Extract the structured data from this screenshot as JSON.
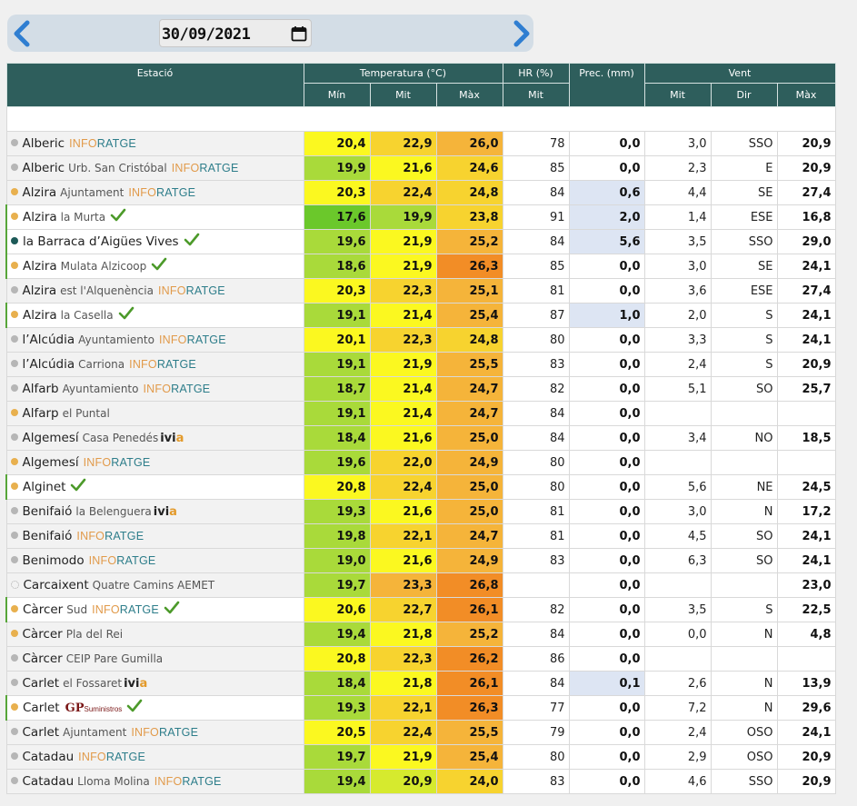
{
  "date_value": "30/09/2021",
  "headers": {
    "station": "Estació",
    "temperature": "Temperatura (°C)",
    "humidity": "HR (%)",
    "precipitation": "Prec. (mm)",
    "wind": "Vent",
    "t_min": "Mín",
    "t_mit": "Mit",
    "t_max": "Màx",
    "hr_mit": "Mit",
    "w_mit": "Mit",
    "w_dir": "Dir",
    "w_max": "Màx"
  },
  "provider_labels": {
    "inforatge_a": "INFO",
    "inforatge_b": "RATGE",
    "ivia_a": "ivi",
    "ivia_b": "a",
    "gp_a": "GP",
    "gp_b": "Suministros"
  },
  "colors": {
    "header_bg": "#2e5e5c",
    "t_dark_green": "#6bc82b",
    "t_green": "#a9da3a",
    "t_yellow_green": "#d6ea2e",
    "t_yellow": "#fbf820",
    "t_gold": "#f7d32f",
    "t_orange_light": "#f5b43a",
    "t_orange": "#f28d26",
    "precip_highlight": "#dde5f3"
  },
  "rows": [
    {
      "name": "Alberic",
      "sub": "",
      "dot": "gray",
      "logo": "inforatge",
      "check": false,
      "tmin": "20,4",
      "tmin_c": "t_yellow",
      "tmit": "22,9",
      "tmit_c": "t_gold",
      "tmax": "26,0",
      "tmax_c": "t_orange_light",
      "hr": "78",
      "prec": "0,0",
      "prec_hl": false,
      "vmit": "3,0",
      "dir": "SSO",
      "vmax": "20,9"
    },
    {
      "name": "Alberic",
      "sub": "Urb. San Cristóbal",
      "dot": "gray",
      "logo": "inforatge",
      "check": false,
      "tmin": "19,9",
      "tmin_c": "t_green",
      "tmit": "21,6",
      "tmit_c": "t_yellow",
      "tmax": "24,6",
      "tmax_c": "t_gold",
      "hr": "85",
      "prec": "0,0",
      "prec_hl": false,
      "vmit": "2,3",
      "dir": "E",
      "vmax": "20,9"
    },
    {
      "name": "Alzira",
      "sub": "Ajuntament",
      "dot": "orange",
      "logo": "inforatge",
      "check": false,
      "tmin": "20,3",
      "tmin_c": "t_yellow",
      "tmit": "22,4",
      "tmit_c": "t_gold",
      "tmax": "24,8",
      "tmax_c": "t_gold",
      "hr": "84",
      "prec": "0,6",
      "prec_hl": true,
      "vmit": "4,4",
      "dir": "SE",
      "vmax": "27,4"
    },
    {
      "name": "Alzira",
      "sub": "la Murta",
      "dot": "orange",
      "logo": "",
      "check": true,
      "tmin": "17,6",
      "tmin_c": "t_dark_green",
      "tmit": "19,9",
      "tmit_c": "t_green",
      "tmax": "23,8",
      "tmax_c": "t_gold",
      "hr": "91",
      "prec": "2,0",
      "prec_hl": true,
      "vmit": "1,4",
      "dir": "ESE",
      "vmax": "16,8"
    },
    {
      "name": "la Barraca d’Aigües Vives",
      "sub": "",
      "dot": "teal",
      "logo": "",
      "check": true,
      "tmin": "19,6",
      "tmin_c": "t_green",
      "tmit": "21,9",
      "tmit_c": "t_yellow",
      "tmax": "25,2",
      "tmax_c": "t_orange_light",
      "hr": "84",
      "prec": "5,6",
      "prec_hl": true,
      "vmit": "3,5",
      "dir": "SSO",
      "vmax": "29,0"
    },
    {
      "name": "Alzira",
      "sub": "Mulata Alzicoop",
      "dot": "orange",
      "logo": "",
      "check": true,
      "tmin": "18,6",
      "tmin_c": "t_green",
      "tmit": "21,9",
      "tmit_c": "t_yellow",
      "tmax": "26,3",
      "tmax_c": "t_orange",
      "hr": "85",
      "prec": "0,0",
      "prec_hl": false,
      "vmit": "3,0",
      "dir": "SE",
      "vmax": "24,1"
    },
    {
      "name": "Alzira",
      "sub": "est l'Alquenència",
      "dot": "gray",
      "logo": "inforatge",
      "check": false,
      "tmin": "20,3",
      "tmin_c": "t_yellow",
      "tmit": "22,3",
      "tmit_c": "t_gold",
      "tmax": "25,1",
      "tmax_c": "t_orange_light",
      "hr": "81",
      "prec": "0,0",
      "prec_hl": false,
      "vmit": "3,6",
      "dir": "ESE",
      "vmax": "27,4"
    },
    {
      "name": "Alzira",
      "sub": "la Casella",
      "dot": "orange",
      "logo": "",
      "check": true,
      "tmin": "19,1",
      "tmin_c": "t_green",
      "tmit": "21,4",
      "tmit_c": "t_yellow",
      "tmax": "25,4",
      "tmax_c": "t_orange_light",
      "hr": "87",
      "prec": "1,0",
      "prec_hl": true,
      "vmit": "2,0",
      "dir": "S",
      "vmax": "24,1"
    },
    {
      "name": "l’Alcúdia",
      "sub": "Ayuntamiento",
      "dot": "gray",
      "logo": "inforatge",
      "check": false,
      "tmin": "20,1",
      "tmin_c": "t_yellow",
      "tmit": "22,3",
      "tmit_c": "t_gold",
      "tmax": "24,8",
      "tmax_c": "t_gold",
      "hr": "80",
      "prec": "0,0",
      "prec_hl": false,
      "vmit": "3,3",
      "dir": "S",
      "vmax": "24,1"
    },
    {
      "name": "l’Alcúdia",
      "sub": "Carriona",
      "dot": "gray",
      "logo": "inforatge",
      "check": false,
      "tmin": "19,1",
      "tmin_c": "t_green",
      "tmit": "21,9",
      "tmit_c": "t_yellow",
      "tmax": "25,5",
      "tmax_c": "t_orange_light",
      "hr": "83",
      "prec": "0,0",
      "prec_hl": false,
      "vmit": "2,4",
      "dir": "S",
      "vmax": "20,9"
    },
    {
      "name": "Alfarb",
      "sub": "Ayuntamiento",
      "dot": "gray",
      "logo": "inforatge",
      "check": false,
      "tmin": "18,7",
      "tmin_c": "t_green",
      "tmit": "21,4",
      "tmit_c": "t_yellow",
      "tmax": "24,7",
      "tmax_c": "t_orange_light",
      "hr": "82",
      "prec": "0,0",
      "prec_hl": false,
      "vmit": "5,1",
      "dir": "SO",
      "vmax": "25,7"
    },
    {
      "name": "Alfarp",
      "sub": "el Puntal",
      "dot": "orange",
      "logo": "",
      "check": false,
      "tmin": "19,1",
      "tmin_c": "t_green",
      "tmit": "21,4",
      "tmit_c": "t_yellow",
      "tmax": "24,7",
      "tmax_c": "t_orange_light",
      "hr": "84",
      "prec": "0,0",
      "prec_hl": false,
      "vmit": "",
      "dir": "",
      "vmax": ""
    },
    {
      "name": "Algemesí",
      "sub": "Casa Penedés",
      "dot": "gray",
      "logo": "ivia",
      "check": false,
      "tmin": "18,4",
      "tmin_c": "t_green",
      "tmit": "21,6",
      "tmit_c": "t_yellow",
      "tmax": "25,0",
      "tmax_c": "t_orange_light",
      "hr": "84",
      "prec": "0,0",
      "prec_hl": false,
      "vmit": "3,4",
      "dir": "NO",
      "vmax": "18,5"
    },
    {
      "name": "Algemesí",
      "sub": "",
      "dot": "orange",
      "logo": "inforatge",
      "check": false,
      "tmin": "19,6",
      "tmin_c": "t_green",
      "tmit": "22,0",
      "tmit_c": "t_gold",
      "tmax": "24,9",
      "tmax_c": "t_orange_light",
      "hr": "80",
      "prec": "0,0",
      "prec_hl": false,
      "vmit": "",
      "dir": "",
      "vmax": ""
    },
    {
      "name": "Alginet",
      "sub": "",
      "dot": "orange",
      "logo": "",
      "check": true,
      "tmin": "20,8",
      "tmin_c": "t_yellow",
      "tmit": "22,4",
      "tmit_c": "t_gold",
      "tmax": "25,0",
      "tmax_c": "t_orange_light",
      "hr": "80",
      "prec": "0,0",
      "prec_hl": false,
      "vmit": "5,6",
      "dir": "NE",
      "vmax": "24,5"
    },
    {
      "name": "Benifaió",
      "sub": "la Belenguera",
      "dot": "gray",
      "logo": "ivia",
      "check": false,
      "tmin": "19,3",
      "tmin_c": "t_green",
      "tmit": "21,6",
      "tmit_c": "t_yellow",
      "tmax": "25,0",
      "tmax_c": "t_orange_light",
      "hr": "81",
      "prec": "0,0",
      "prec_hl": false,
      "vmit": "3,0",
      "dir": "N",
      "vmax": "17,2"
    },
    {
      "name": "Benifaió",
      "sub": "",
      "dot": "gray",
      "logo": "inforatge",
      "check": false,
      "tmin": "19,8",
      "tmin_c": "t_green",
      "tmit": "22,1",
      "tmit_c": "t_gold",
      "tmax": "24,7",
      "tmax_c": "t_orange_light",
      "hr": "81",
      "prec": "0,0",
      "prec_hl": false,
      "vmit": "4,5",
      "dir": "SO",
      "vmax": "24,1"
    },
    {
      "name": "Benimodo",
      "sub": "",
      "dot": "gray",
      "logo": "inforatge",
      "check": false,
      "tmin": "19,0",
      "tmin_c": "t_green",
      "tmit": "21,6",
      "tmit_c": "t_yellow",
      "tmax": "24,9",
      "tmax_c": "t_orange_light",
      "hr": "83",
      "prec": "0,0",
      "prec_hl": false,
      "vmit": "6,3",
      "dir": "SO",
      "vmax": "24,1"
    },
    {
      "name": "Carcaixent",
      "sub": "Quatre Camins AEMET",
      "dot": "empty",
      "logo": "",
      "check": false,
      "tmin": "19,7",
      "tmin_c": "t_green",
      "tmit": "23,3",
      "tmit_c": "t_orange_light",
      "tmax": "26,8",
      "tmax_c": "t_orange",
      "hr": "",
      "prec": "0,0",
      "prec_hl": false,
      "vmit": "",
      "dir": "",
      "vmax": "23,0"
    },
    {
      "name": "Càrcer",
      "sub": "Sud",
      "dot": "orange",
      "logo": "inforatge",
      "check": true,
      "tmin": "20,6",
      "tmin_c": "t_yellow",
      "tmit": "22,7",
      "tmit_c": "t_gold",
      "tmax": "26,1",
      "tmax_c": "t_orange",
      "hr": "82",
      "prec": "0,0",
      "prec_hl": false,
      "vmit": "3,5",
      "dir": "S",
      "vmax": "22,5"
    },
    {
      "name": "Càrcer",
      "sub": "Pla del Rei",
      "dot": "orange",
      "logo": "",
      "check": false,
      "tmin": "19,4",
      "tmin_c": "t_green",
      "tmit": "21,8",
      "tmit_c": "t_yellow",
      "tmax": "25,2",
      "tmax_c": "t_orange_light",
      "hr": "84",
      "prec": "0,0",
      "prec_hl": false,
      "vmit": "0,0",
      "dir": "N",
      "vmax": "4,8"
    },
    {
      "name": "Càrcer",
      "sub": "CEIP Pare Gumilla",
      "dot": "gray",
      "logo": "",
      "check": false,
      "tmin": "20,8",
      "tmin_c": "t_yellow",
      "tmit": "22,3",
      "tmit_c": "t_gold",
      "tmax": "26,2",
      "tmax_c": "t_orange",
      "hr": "86",
      "prec": "0,0",
      "prec_hl": false,
      "vmit": "",
      "dir": "",
      "vmax": ""
    },
    {
      "name": "Carlet",
      "sub": "el Fossaret",
      "dot": "gray",
      "logo": "ivia",
      "check": false,
      "tmin": "18,4",
      "tmin_c": "t_green",
      "tmit": "21,8",
      "tmit_c": "t_yellow",
      "tmax": "26,1",
      "tmax_c": "t_orange",
      "hr": "84",
      "prec": "0,1",
      "prec_hl": true,
      "vmit": "2,6",
      "dir": "N",
      "vmax": "13,9"
    },
    {
      "name": "Carlet",
      "sub": "",
      "dot": "orange",
      "logo": "gp",
      "check": true,
      "tmin": "19,3",
      "tmin_c": "t_green",
      "tmit": "22,1",
      "tmit_c": "t_gold",
      "tmax": "26,3",
      "tmax_c": "t_orange",
      "hr": "77",
      "prec": "0,0",
      "prec_hl": false,
      "vmit": "7,2",
      "dir": "N",
      "vmax": "29,6"
    },
    {
      "name": "Carlet",
      "sub": "Ajuntament",
      "dot": "gray",
      "logo": "inforatge",
      "check": false,
      "tmin": "20,5",
      "tmin_c": "t_yellow",
      "tmit": "22,4",
      "tmit_c": "t_gold",
      "tmax": "25,5",
      "tmax_c": "t_orange_light",
      "hr": "79",
      "prec": "0,0",
      "prec_hl": false,
      "vmit": "2,4",
      "dir": "OSO",
      "vmax": "24,1"
    },
    {
      "name": "Catadau",
      "sub": "",
      "dot": "gray",
      "logo": "inforatge",
      "check": false,
      "tmin": "19,7",
      "tmin_c": "t_green",
      "tmit": "21,9",
      "tmit_c": "t_yellow",
      "tmax": "25,4",
      "tmax_c": "t_orange_light",
      "hr": "80",
      "prec": "0,0",
      "prec_hl": false,
      "vmit": "2,9",
      "dir": "OSO",
      "vmax": "20,9"
    },
    {
      "name": "Catadau",
      "sub": "Lloma Molina",
      "dot": "gray",
      "logo": "inforatge",
      "check": false,
      "tmin": "19,4",
      "tmin_c": "t_green",
      "tmit": "20,9",
      "tmit_c": "t_yellow_green",
      "tmax": "24,0",
      "tmax_c": "t_gold",
      "hr": "83",
      "prec": "0,0",
      "prec_hl": false,
      "vmit": "4,6",
      "dir": "SSO",
      "vmax": "20,9"
    }
  ]
}
